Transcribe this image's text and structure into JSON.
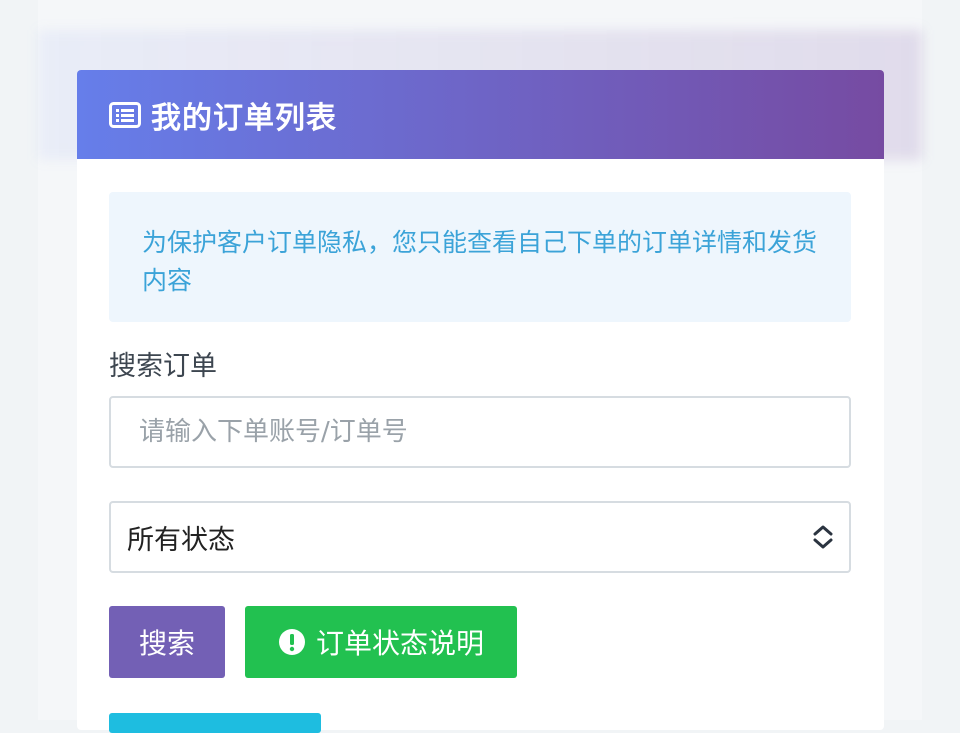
{
  "header": {
    "title": "我的订单列表",
    "icon": "list-icon"
  },
  "notice": {
    "text": "为保护客户订单隐私，您只能查看自己下单的订单详情和发货内容"
  },
  "search": {
    "label": "搜索订单",
    "placeholder": "请输入下单账号/订单号",
    "value": ""
  },
  "status_filter": {
    "selected": "所有状态"
  },
  "buttons": {
    "search_label": "搜索",
    "status_help_label": "订单状态说明"
  },
  "colors": {
    "header_gradient_start": "#667eea",
    "header_gradient_end": "#764ba2",
    "notice_text": "#3ba3d8",
    "search_button": "#7360b5",
    "status_button": "#22c150",
    "partial_button": "#1ebde0"
  }
}
